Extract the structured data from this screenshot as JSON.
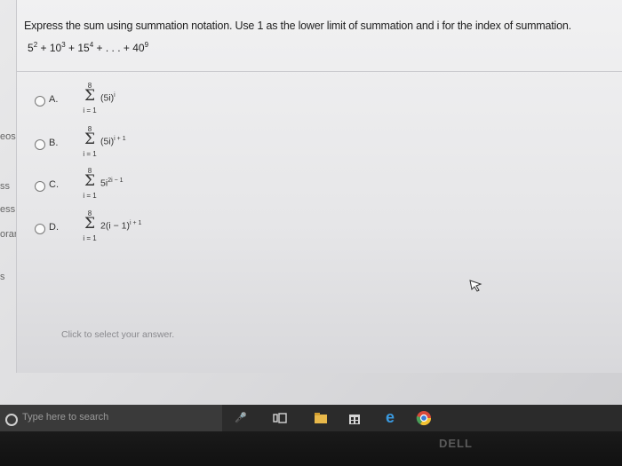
{
  "sidebar": {
    "partial_labels": [
      "eos",
      "ss",
      "ess",
      "orary",
      "s"
    ]
  },
  "question": {
    "prompt": "Express the sum using summation notation. Use 1 as the lower limit of summation and i for the index of summation.",
    "series_terms": [
      {
        "base": "5",
        "exp": "2"
      },
      {
        "base": "10",
        "exp": "3"
      },
      {
        "base": "15",
        "exp": "4"
      },
      {
        "base": "40",
        "exp": "9"
      }
    ],
    "series_plus": "+",
    "series_ellipsis": "+ . . . +"
  },
  "options": [
    {
      "letter": "A.",
      "upper": "8",
      "lower": "i = 1",
      "base": "(5i)",
      "exp": "i"
    },
    {
      "letter": "B.",
      "upper": "8",
      "lower": "i = 1",
      "base": "(5i)",
      "exp": "i + 1"
    },
    {
      "letter": "C.",
      "upper": "8",
      "lower": "i = 1",
      "base": "5i",
      "exp": "2i − 1"
    },
    {
      "letter": "D.",
      "upper": "8",
      "lower": "i = 1",
      "base": "2(i − 1)",
      "exp": "i + 1"
    }
  ],
  "hint": "Click to select your answer.",
  "taskbar": {
    "search_placeholder": "Type here to search",
    "icons": [
      "microphone-icon",
      "task-view-icon",
      "file-explorer-icon",
      "store-icon",
      "edge-icon",
      "chrome-icon"
    ]
  },
  "bezel": {
    "brand": "DELL"
  },
  "sigma": "Σ"
}
